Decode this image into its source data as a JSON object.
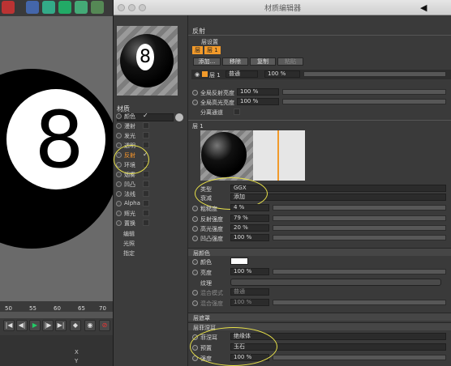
{
  "background_app": {
    "timeline_ticks": [
      "50",
      "55",
      "60",
      "65",
      "70"
    ],
    "ball_number": "8",
    "coord_labels": [
      "X",
      "Y"
    ]
  },
  "window": {
    "title": "材质编辑器",
    "back_arrow": "◀"
  },
  "left_panel": {
    "preview_number": "8",
    "material_name": "材质",
    "channels": [
      {
        "label": "颜色",
        "checked": true
      },
      {
        "label": "漫射",
        "checked": false
      },
      {
        "label": "发光",
        "checked": false
      },
      {
        "label": "透明",
        "checked": false
      },
      {
        "label": "反射",
        "checked": true,
        "active": true
      },
      {
        "label": "环境",
        "checked": false
      },
      {
        "label": "烟雾",
        "checked": false
      },
      {
        "label": "凹凸",
        "checked": false
      },
      {
        "label": "法线",
        "checked": false
      },
      {
        "label": "Alpha",
        "checked": false
      },
      {
        "label": "辉光",
        "checked": false
      },
      {
        "label": "置换",
        "checked": false
      }
    ],
    "extras": [
      "编辑",
      "光照",
      "指定"
    ]
  },
  "right_panel": {
    "header": "反射",
    "layer_settings": "层设置",
    "layer_tabs": [
      "层",
      "层 1"
    ],
    "buttons": [
      "添加...",
      "移除",
      "复制",
      "粘贴"
    ],
    "layer_row": {
      "name": "层 1",
      "mode": "普通",
      "value": "100 %"
    },
    "global_reflect": {
      "label": "全局反射亮度",
      "value": "100 %"
    },
    "global_specular": {
      "label": "全局高光亮度",
      "value": "100 %"
    },
    "separate_pass": "分离通道",
    "layer1_title": "层 1",
    "type": {
      "label": "类型",
      "value": "GGX"
    },
    "attenuation": {
      "label": "衰减",
      "value": "添加"
    },
    "roughness": {
      "label": "粗糙度",
      "value": "4 %"
    },
    "reflect_strength": {
      "label": "反射强度",
      "value": "79 %"
    },
    "specular_strength": {
      "label": "高光强度",
      "value": "20 %"
    },
    "bump_strength": {
      "label": "凹凸强度",
      "value": "100 %"
    },
    "layer_color_section": "层颜色",
    "color_label": "颜色",
    "brightness": {
      "label": "亮度",
      "value": "100 %"
    },
    "texture_label": "纹理",
    "mix_mode": {
      "label": "混合模式",
      "value": "普通"
    },
    "mix_strength": {
      "label": "混合强度",
      "value": "100 %"
    },
    "layer_mask_section": "层遮罩",
    "layer_fresnel_section": "层菲涅耳",
    "fresnel": {
      "label": "菲涅耳",
      "value": "绝缘体"
    },
    "preset": {
      "label": "预置",
      "value": "玉石"
    },
    "strength": {
      "label": "强度",
      "value": "100 %"
    }
  },
  "colors": {
    "accent": "#f29a2a",
    "highlight": "#e9e24a",
    "color_swatch": "#ffffff"
  }
}
